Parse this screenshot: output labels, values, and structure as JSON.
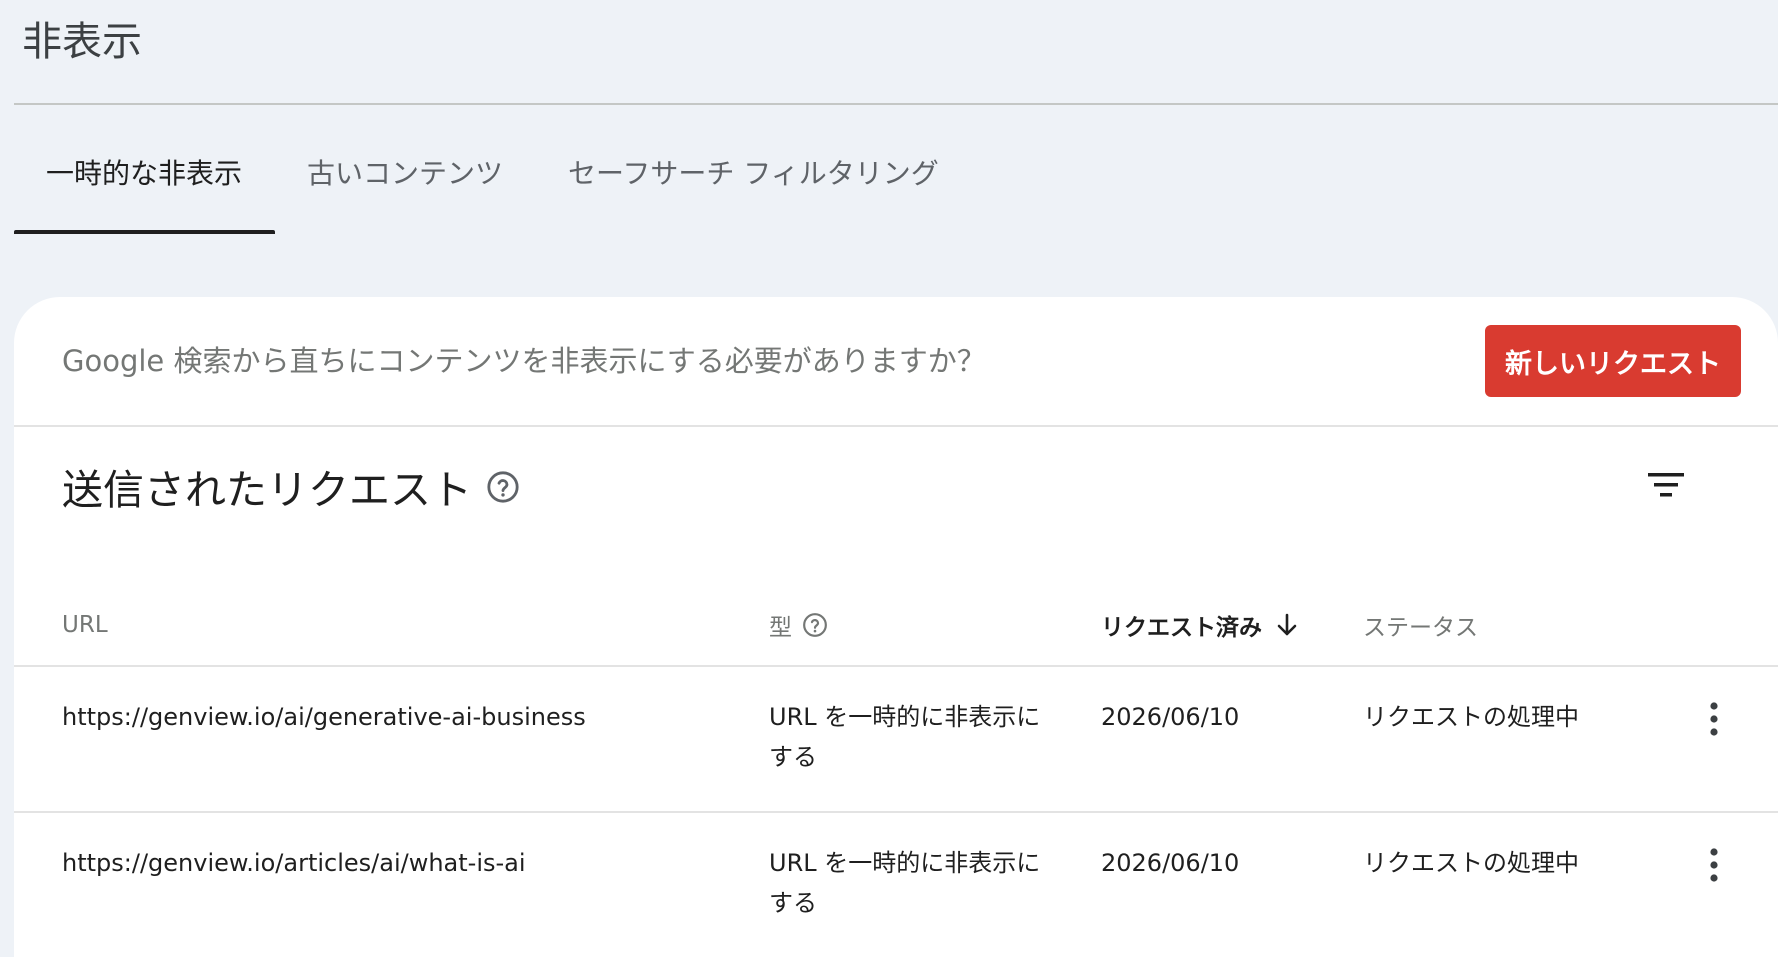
{
  "page": {
    "title": "非表示"
  },
  "tabs": [
    {
      "label": "一時的な非表示",
      "active": true
    },
    {
      "label": "古いコンテンツ",
      "active": false
    },
    {
      "label": "セーフサーチ フィルタリング",
      "active": false
    }
  ],
  "prompt": {
    "text": "Google 検索から直ちにコンテンツを非表示にする必要がありますか？",
    "button_label": "新しいリクエスト"
  },
  "requests": {
    "title": "送信されたリクエスト",
    "columns": {
      "url": "URL",
      "type": "型",
      "requested": "リクエスト済み",
      "status": "ステータス"
    },
    "rows": [
      {
        "url": "https://genview.io/ai/generative-ai-business",
        "type": "URL を一時的に非表示にする",
        "date": "2026/06/10",
        "status": "リクエストの処理中"
      },
      {
        "url": "https://genview.io/articles/ai/what-is-ai",
        "type": "URL を一時的に非表示にする",
        "date": "2026/06/10",
        "status": "リクエストの処理中"
      }
    ]
  },
  "colors": {
    "background": "#eef2f7",
    "accent_button": "#d93b30",
    "card": "#ffffff"
  },
  "icons": [
    "help-circle-icon",
    "filter-icon",
    "arrow-down-icon",
    "more-vert-icon"
  ]
}
